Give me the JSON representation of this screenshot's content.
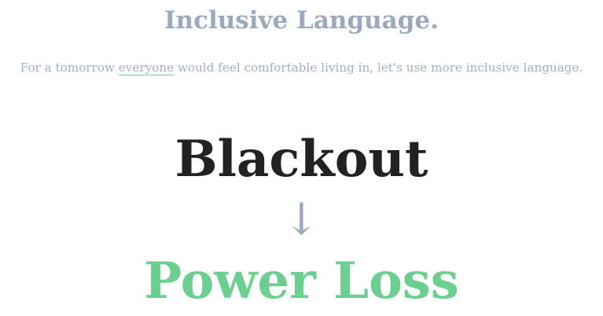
{
  "header": {
    "title": "Inclusive Language.",
    "tagline_before": "For a tomorrow ",
    "tagline_link": "everyone",
    "tagline_after": " would feel comfortable living in, let's use more inclusive language."
  },
  "term": {
    "old": "Blackout",
    "arrow": "↓",
    "new": "Power Loss"
  },
  "colors": {
    "muted": "#9aa9bd",
    "accent": "#6bcf8f",
    "dark": "#222222"
  }
}
